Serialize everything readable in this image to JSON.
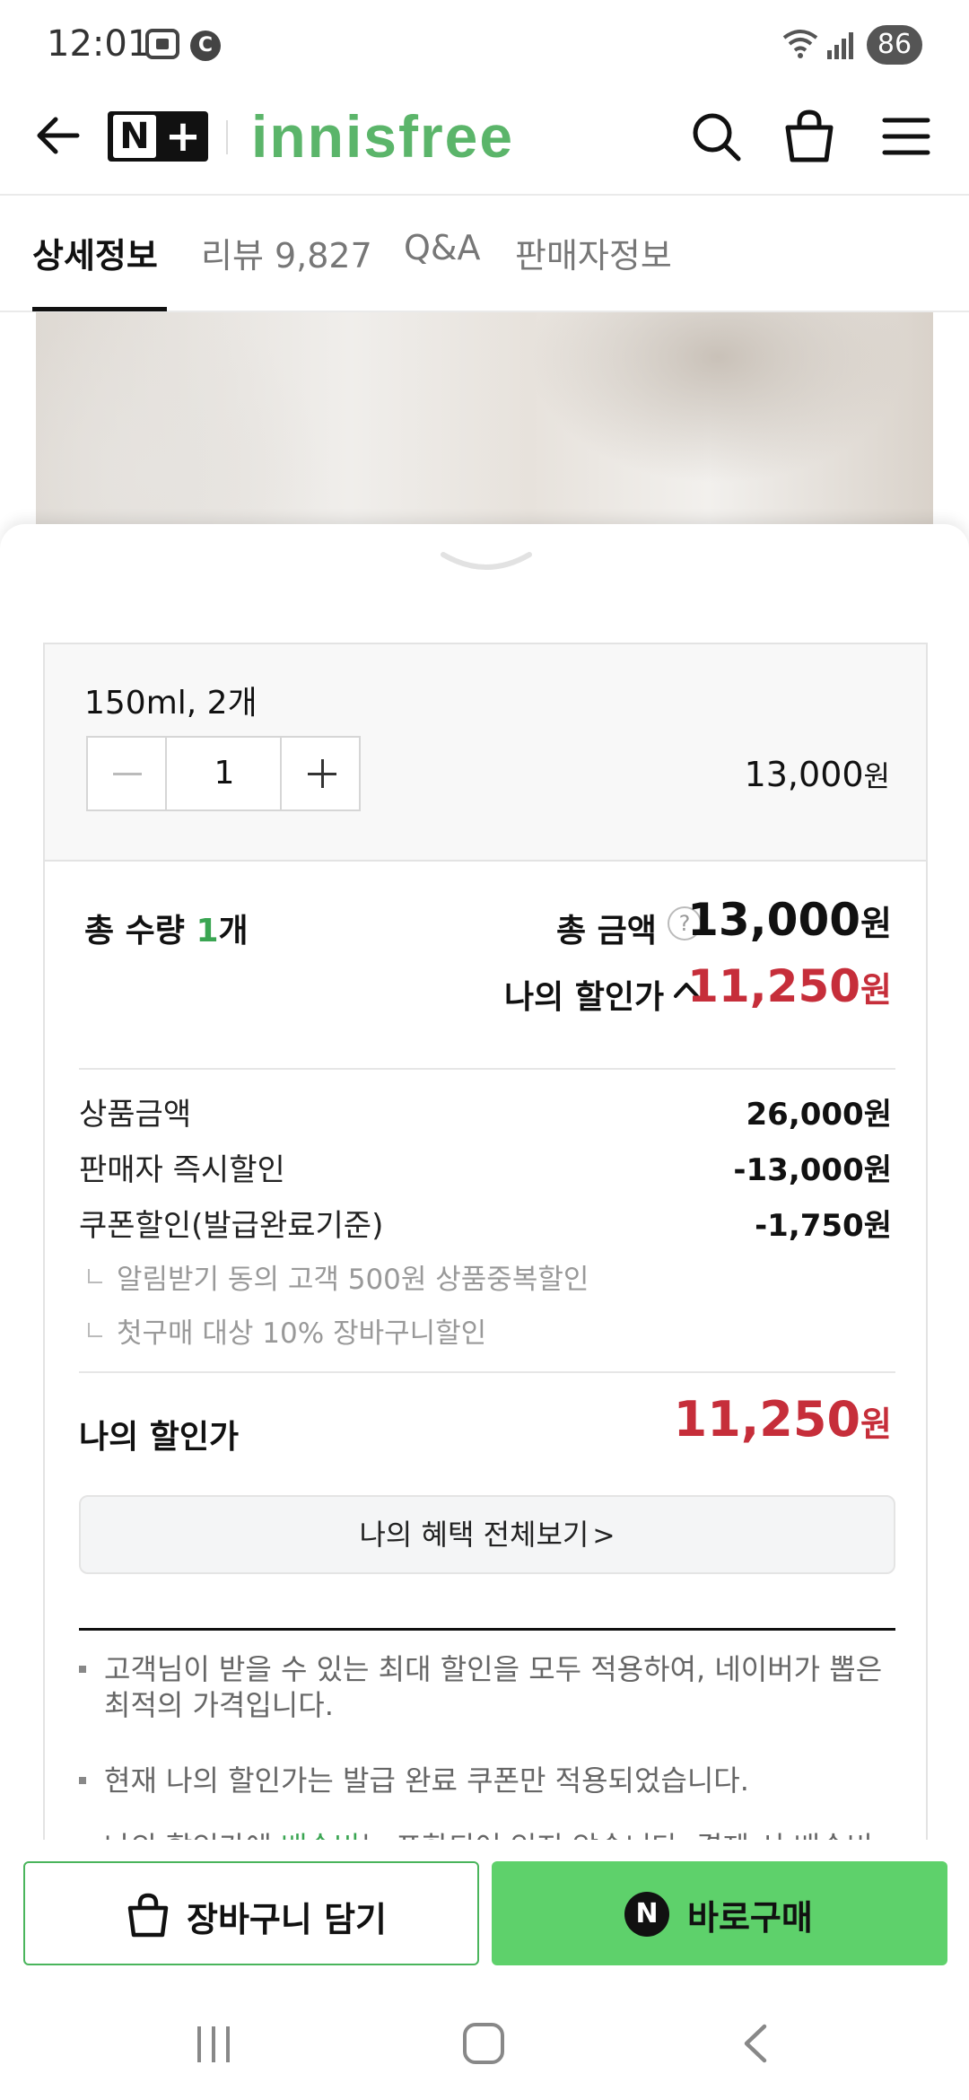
{
  "status_bar": {
    "time": "12:01",
    "battery": "86",
    "notification_icons": [
      "screenshot-icon",
      "c-icon"
    ],
    "system_icons": [
      "wifi-icon",
      "signal-icon"
    ]
  },
  "header": {
    "badge_n": "N",
    "badge_plus": "+",
    "brand": "innisfree",
    "icons": [
      "back-arrow-icon",
      "search-icon",
      "shopping-bag-icon",
      "hamburger-menu-icon"
    ]
  },
  "tabs": [
    {
      "label": "상세정보",
      "active": true
    },
    {
      "label": "리뷰 9,827",
      "active": false
    },
    {
      "label": "Q&A",
      "active": false
    },
    {
      "label": "판매자정보",
      "active": false
    }
  ],
  "option": {
    "name": "150ml, 2개",
    "quantity": "1",
    "price": "13,000",
    "currency": "원"
  },
  "summary": {
    "qty_prefix": "총 수량 ",
    "qty_value": "1",
    "qty_suffix": "개",
    "total_label": "총 금액",
    "help_mark": "?",
    "total_price": "13,000",
    "my_discount_label": "나의 할인가",
    "my_discount_price": "11,250",
    "currency": "원"
  },
  "breakdown": [
    {
      "label": "상품금액",
      "value": "26,000원"
    },
    {
      "label": "판매자 즉시할인",
      "value": "-13,000원"
    },
    {
      "label": "쿠폰할인(발급완료기준)",
      "value": "-1,750원"
    }
  ],
  "sub_discounts": [
    "알림받기 동의 고객 500원 상품중복할인",
    "첫구매 대상 10% 장바구니할인"
  ],
  "final": {
    "label": "나의 할인가",
    "price": "11,250",
    "currency": "원"
  },
  "benefit_button": {
    "label": "나의 혜택 전체보기",
    "chevron": ">"
  },
  "notices": {
    "n1": "고객님이 받을 수 있는 최대 할인을 모두 적용하여, 네이버가 뽑은 최적의 가격입니다.",
    "n2": "현재 나의 할인가는 발급 완료 쿠폰만 적용되었습니다.",
    "n3_prefix": "나의 할인가에 ",
    "n3_highlight": "배송비",
    "n3_suffix": "는 포함되어 있지 않습니다. 결제 시 배송비가"
  },
  "actions": {
    "cart_label": "장바구니 담기",
    "buy_icon_text": "N",
    "buy_label": "바로구매"
  },
  "colors": {
    "brand_green": "#5bb56a",
    "buy_button": "#5ed16b",
    "discount_red": "#c62e3a",
    "qty_green": "#3aa552"
  }
}
